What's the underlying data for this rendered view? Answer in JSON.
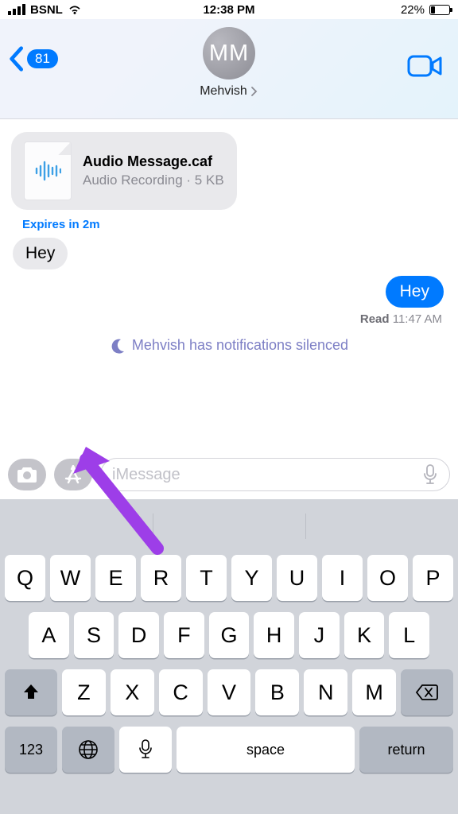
{
  "statusbar": {
    "carrier": "BSNL",
    "time": "12:38 PM",
    "battery_pct": "22%"
  },
  "header": {
    "badge_count": "81",
    "avatar_initials": "MM",
    "contact_name": "Mehvish"
  },
  "thread": {
    "audio": {
      "filename": "Audio Message.caf",
      "subtitle": "Audio Recording · 5 KB"
    },
    "expires": "Expires in 2m",
    "msg_in": "Hey",
    "msg_out": "Hey",
    "read_label": "Read",
    "read_time": "11:47 AM",
    "silenced": "Mehvish has notifications silenced"
  },
  "compose": {
    "placeholder": "iMessage"
  },
  "keyboard": {
    "row1": [
      "Q",
      "W",
      "E",
      "R",
      "T",
      "Y",
      "U",
      "I",
      "O",
      "P"
    ],
    "row2": [
      "A",
      "S",
      "D",
      "F",
      "G",
      "H",
      "J",
      "K",
      "L"
    ],
    "row3": [
      "Z",
      "X",
      "C",
      "V",
      "B",
      "N",
      "M"
    ],
    "numkey": "123",
    "space": "space",
    "return": "return"
  }
}
